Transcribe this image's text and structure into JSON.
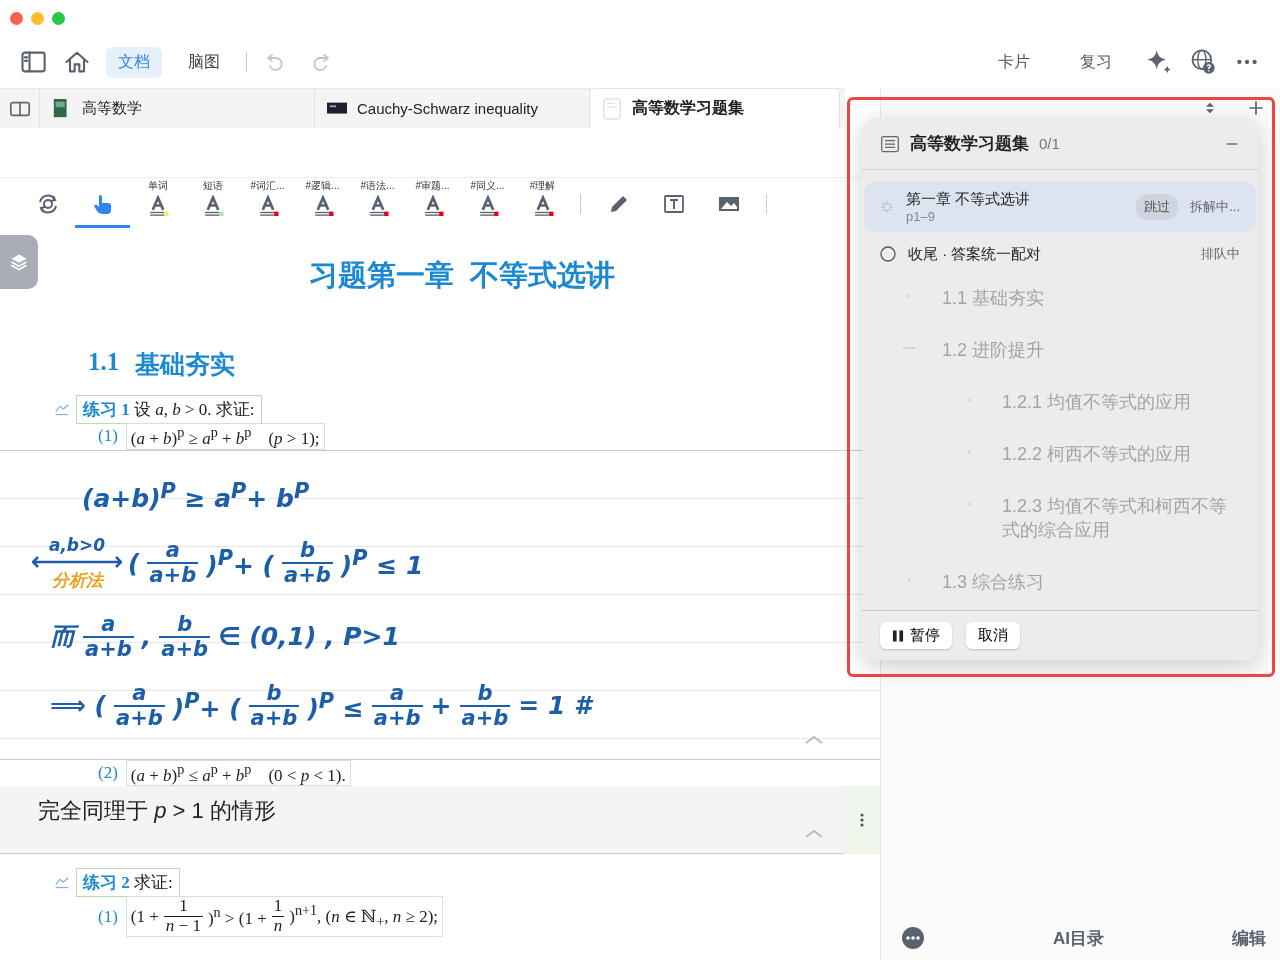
{
  "toolbar": {
    "modes": [
      {
        "label": "文档",
        "selected": true
      },
      {
        "label": "脑图",
        "selected": false
      }
    ],
    "history": [
      {
        "kind": "undo",
        "disabled": true
      },
      {
        "kind": "redo",
        "disabled": true
      }
    ],
    "actions": [
      {
        "label": "卡片"
      },
      {
        "label": "复习"
      }
    ]
  },
  "tabs": [
    {
      "label": "高等数学",
      "kind": "book",
      "selected": false
    },
    {
      "label": "Cauchy-Schwarz inequality",
      "kind": "video",
      "selected": false
    },
    {
      "label": "高等数学习题集",
      "kind": "document",
      "selected": true
    }
  ],
  "annotation_tools": [
    {
      "kind": "rotate",
      "selected": false
    },
    {
      "kind": "hand",
      "selected": true
    },
    {
      "kind": "highlight",
      "label": "单词",
      "color": "#f3ea6a",
      "selected": false
    },
    {
      "kind": "highlight",
      "label": "短语",
      "color": "#a6ec9c",
      "selected": false
    },
    {
      "kind": "highlight",
      "label": "#词汇...",
      "color": "#e60012",
      "selected": false
    },
    {
      "kind": "highlight",
      "label": "#逻辑...",
      "color": "#e60012",
      "selected": false
    },
    {
      "kind": "highlight",
      "label": "#语法...",
      "color": "#e60012",
      "selected": false
    },
    {
      "kind": "highlight",
      "label": "#审题...",
      "color": "#e60012",
      "selected": false
    },
    {
      "kind": "highlight",
      "label": "#同义...",
      "color": "#e60012",
      "selected": false
    },
    {
      "kind": "highlight",
      "label": "#理解",
      "color": "#e60012",
      "selected": false
    },
    {
      "kind": "divider"
    },
    {
      "kind": "pencil",
      "selected": false
    },
    {
      "kind": "textbox",
      "selected": false
    },
    {
      "kind": "image",
      "selected": false
    },
    {
      "kind": "divider"
    }
  ],
  "document": {
    "blocks": [
      {
        "kind": "chapter",
        "text": "习题第一章  不等式选讲"
      },
      {
        "kind": "section",
        "number": "1.1",
        "text": "基础夯实"
      },
      {
        "kind": "exercise",
        "label": "练习 1",
        "text": "设 *a*, *b* > 0. 求证:"
      },
      {
        "kind": "item",
        "number": "(1)",
        "formula": [
          {
            "kind": "text",
            "text": "(*a* + *b*)$^{p}$ ≥ *a*$^{p}$ + *b*$^{p}$    (*p* > 1);"
          }
        ]
      },
      {
        "kind": "handwriting",
        "lines": [
          [
            {
              "kind": "text",
              "text": "(a+b)$^{P}$ ≥ a$^{P}$+ b$^{P}$"
            }
          ],
          [
            {
              "kind": "arrow",
              "above": "a,b>0",
              "below": "分析法"
            },
            {
              "kind": "text",
              "text": "("
            },
            {
              "kind": "frac",
              "num": "a",
              "den": "a+b"
            },
            {
              "kind": "text",
              "text": ")$^{P}$+ ("
            },
            {
              "kind": "frac",
              "num": "b",
              "den": "a+b"
            },
            {
              "kind": "text",
              "text": ")$^{P}$ ≤ 1"
            }
          ],
          [
            {
              "kind": "text",
              "text": "而"
            },
            {
              "kind": "frac",
              "num": "a",
              "den": "a+b"
            },
            {
              "kind": "text",
              "text": ","
            },
            {
              "kind": "frac",
              "num": "b",
              "den": "a+b"
            },
            {
              "kind": "text",
              "text": "∈ (0,1) , P>1"
            }
          ],
          [
            {
              "kind": "text",
              "text": "⟹ ("
            },
            {
              "kind": "frac",
              "num": "a",
              "den": "a+b"
            },
            {
              "kind": "text",
              "text": ")$^{P}$+ ("
            },
            {
              "kind": "frac",
              "num": "b",
              "den": "a+b"
            },
            {
              "kind": "text",
              "text": ")$^{P}$ ≤"
            },
            {
              "kind": "frac",
              "num": "a",
              "den": "a+b"
            },
            {
              "kind": "text",
              "text": "+"
            },
            {
              "kind": "frac",
              "num": "b",
              "den": "a+b"
            },
            {
              "kind": "text",
              "text": "= 1 #"
            }
          ]
        ]
      },
      {
        "kind": "item",
        "number": "(2)",
        "formula": [
          {
            "kind": "text",
            "text": "(*a* + *b*)$^{p}$ ≤ *a*$^{p}$ + *b*$^{p}$    (0 < *p* < 1)."
          }
        ]
      },
      {
        "kind": "note",
        "text": "完全同理于 *p* > 1 的情形"
      },
      {
        "kind": "exercise",
        "label": "练习 2",
        "text": "求证:"
      },
      {
        "kind": "item",
        "number": "(1)",
        "formula": [
          {
            "kind": "text",
            "text": "(1 +"
          },
          {
            "kind": "frac",
            "num": "1",
            "den": "*n* − 1"
          },
          {
            "kind": "text",
            "text": ")$^{n}$ > (1 +"
          },
          {
            "kind": "frac",
            "num": "1",
            "den": "*n*"
          },
          {
            "kind": "text",
            "text": ")$^{n+1}$, (*n* ∈ ℕ$_{+}$, *n* ≥ 2);"
          }
        ]
      }
    ]
  },
  "sidebar": {
    "task_panel": {
      "title": "高等数学习题集",
      "progress": "0/1",
      "tasks": [
        {
          "kind": "running",
          "title": "第一章 不等式选讲",
          "pages": "p1–9",
          "skip_label": "跳过",
          "status": "拆解中...",
          "selected": true
        },
        {
          "kind": "queued",
          "title": "收尾 · 答案统一配对",
          "status": "排队中",
          "selected": false
        }
      ],
      "outline": [
        {
          "text": "1.1 基础夯实"
        },
        {
          "text": "1.2 进阶提升",
          "children": [
            {
              "text": "1.2.1 均值不等式的应用"
            },
            {
              "text": "1.2.2 柯西不等式的应用"
            },
            {
              "text": "1.2.3 均值不等式和柯西不等式的综合应用"
            }
          ]
        },
        {
          "text": "1.3 综合练习"
        }
      ],
      "buttons": [
        {
          "kind": "pause",
          "label": "暂停"
        },
        {
          "kind": "cancel",
          "label": "取消"
        }
      ]
    },
    "bottom_bar": {
      "center": "AI目录",
      "right": "编辑"
    }
  }
}
